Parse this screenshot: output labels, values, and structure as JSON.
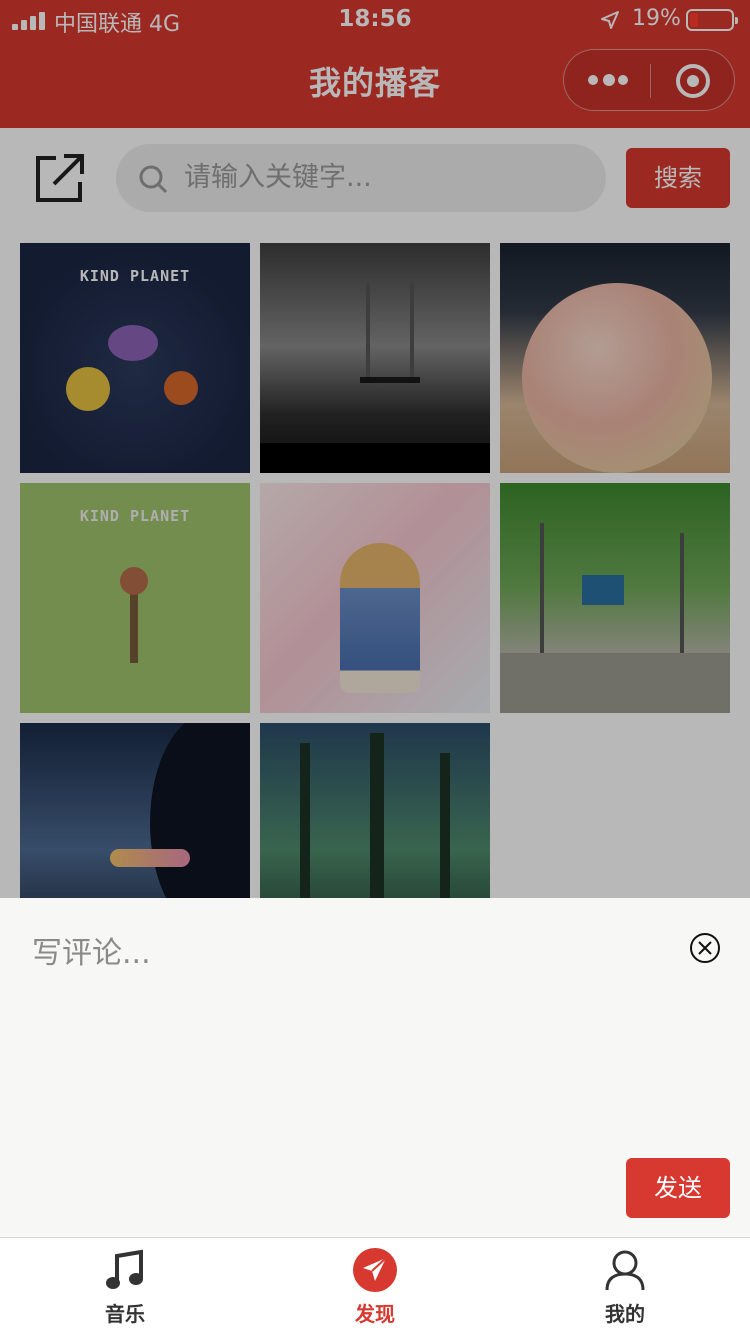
{
  "status_bar": {
    "carrier": "中国联通  4G",
    "time": "18:56",
    "battery": "19%"
  },
  "nav": {
    "title": "我的播客"
  },
  "search": {
    "placeholder": "请输入关键字...",
    "button_label": "搜索"
  },
  "grid": {
    "tiles": [
      {
        "text": "KIND PLANET"
      },
      {
        "text": ""
      },
      {
        "text": ""
      },
      {
        "text": "KIND PLANET"
      },
      {
        "text": ""
      },
      {
        "text": ""
      },
      {
        "text": ""
      },
      {
        "text": ""
      }
    ]
  },
  "comment": {
    "placeholder": "写评论...",
    "send_label": "发送"
  },
  "tabbar": {
    "items": [
      {
        "label": "音乐",
        "icon": "music-note-icon"
      },
      {
        "label": "发现",
        "icon": "paper-plane-icon"
      },
      {
        "label": "我的",
        "icon": "user-icon"
      }
    ],
    "active_color": "#d7382f"
  },
  "colors": {
    "brand": "#d7382f"
  }
}
